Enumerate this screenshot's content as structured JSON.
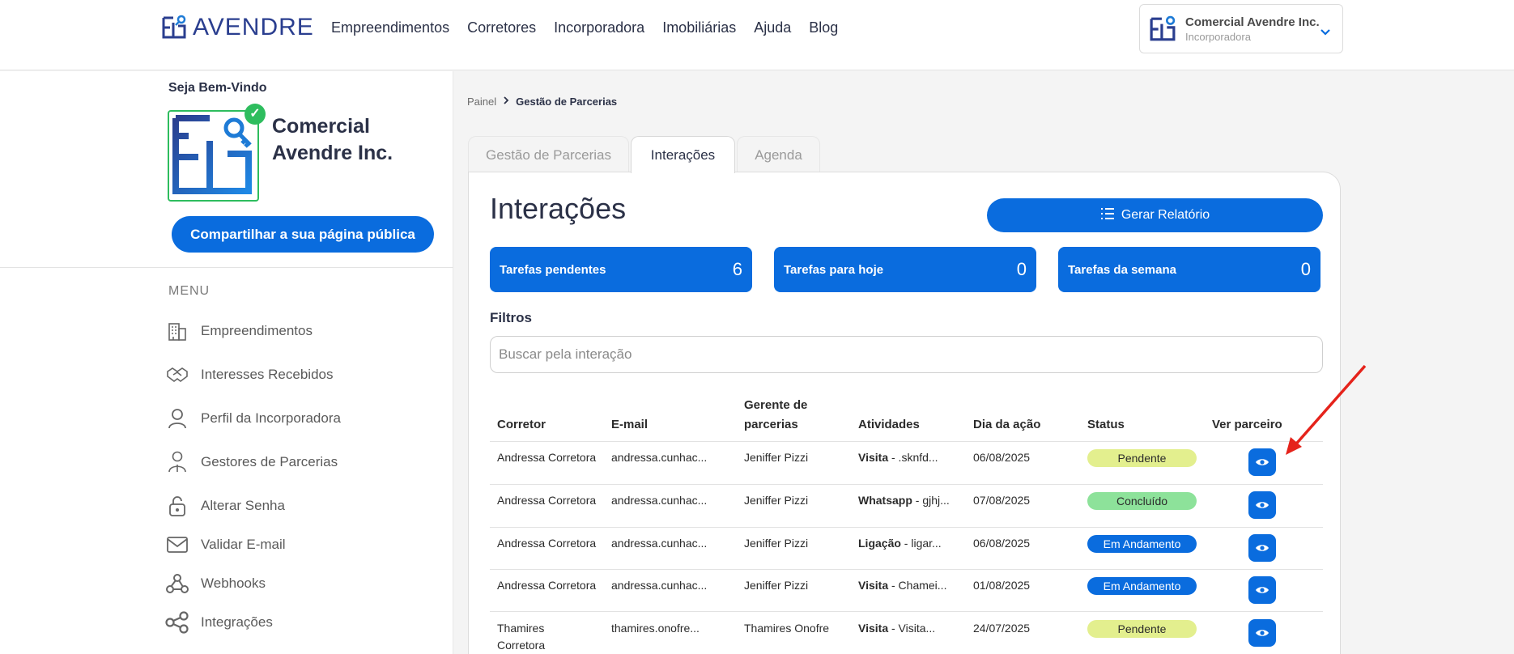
{
  "brand": {
    "name": "AVENDRE"
  },
  "nav": [
    "Empreendimentos",
    "Corretores",
    "Incorporadora",
    "Imobiliárias",
    "Ajuda",
    "Blog"
  ],
  "account": {
    "name": "Comercial Avendre Inc.",
    "role": "Incorporadora"
  },
  "sidebar": {
    "welcome": "Seja Bem-Vindo",
    "company": "Comercial Avendre Inc.",
    "share_button": "Compartilhar a sua página pública",
    "menu_title": "MENU",
    "items": [
      {
        "label": "Empreendimentos",
        "icon": "building-icon"
      },
      {
        "label": "Interesses Recebidos",
        "icon": "handshake-icon"
      },
      {
        "label": "Perfil da Incorporadora",
        "icon": "user-icon"
      },
      {
        "label": "Gestores de Parcerias",
        "icon": "user-manager-icon"
      },
      {
        "label": "Alterar Senha",
        "icon": "lock-icon"
      },
      {
        "label": "Validar E-mail",
        "icon": "mail-icon"
      },
      {
        "label": "Webhooks",
        "icon": "webhook-icon"
      },
      {
        "label": "Integrações",
        "icon": "share-nodes-icon"
      }
    ]
  },
  "breadcrumb": {
    "home": "Painel",
    "current": "Gestão de Parcerias"
  },
  "tabs": [
    "Gestão de Parcerias",
    "Interações",
    "Agenda"
  ],
  "active_tab": "Interações",
  "panel": {
    "title": "Interações",
    "report_button": "Gerar Relatório",
    "stats": [
      {
        "label": "Tarefas pendentes",
        "value": "6"
      },
      {
        "label": "Tarefas para hoje",
        "value": "0"
      },
      {
        "label": "Tarefas da semana",
        "value": "0"
      }
    ],
    "filters_label": "Filtros",
    "search_placeholder": "Buscar pela interação"
  },
  "table": {
    "headers": [
      "Corretor",
      "E-mail",
      "Gerente de parcerias",
      "Atividades",
      "Dia da ação",
      "Status",
      "Ver parceiro"
    ],
    "rows": [
      {
        "corretor": "Andressa Corretora",
        "email": "andressa.cunhac...",
        "gerente": "Jeniffer Pizzi",
        "atividade_tipo": "Visita",
        "atividade_desc": " - .sknfd...",
        "dia": "06/08/2025",
        "status": "Pendente"
      },
      {
        "corretor": "Andressa Corretora",
        "email": "andressa.cunhac...",
        "gerente": "Jeniffer Pizzi",
        "atividade_tipo": "Whatsapp",
        "atividade_desc": " - gjhj...",
        "dia": "07/08/2025",
        "status": "Concluído"
      },
      {
        "corretor": "Andressa Corretora",
        "email": "andressa.cunhac...",
        "gerente": "Jeniffer Pizzi",
        "atividade_tipo": "Ligação",
        "atividade_desc": " - ligar...",
        "dia": "06/08/2025",
        "status": "Em Andamento"
      },
      {
        "corretor": "Andressa Corretora",
        "email": "andressa.cunhac...",
        "gerente": "Jeniffer Pizzi",
        "atividade_tipo": "Visita",
        "atividade_desc": " - Chamei...",
        "dia": "01/08/2025",
        "status": "Em Andamento"
      },
      {
        "corretor": "Thamires Corretora",
        "email": "thamires.onofre...",
        "gerente": "Thamires Onofre",
        "atividade_tipo": "Visita",
        "atividade_desc": " - Visita...",
        "dia": "24/07/2025",
        "status": "Pendente"
      }
    ]
  },
  "colors": {
    "primary": "#0a6cde",
    "pending": "#e3ef8e",
    "done": "#8de29a",
    "annotation_arrow": "#e5231b"
  }
}
